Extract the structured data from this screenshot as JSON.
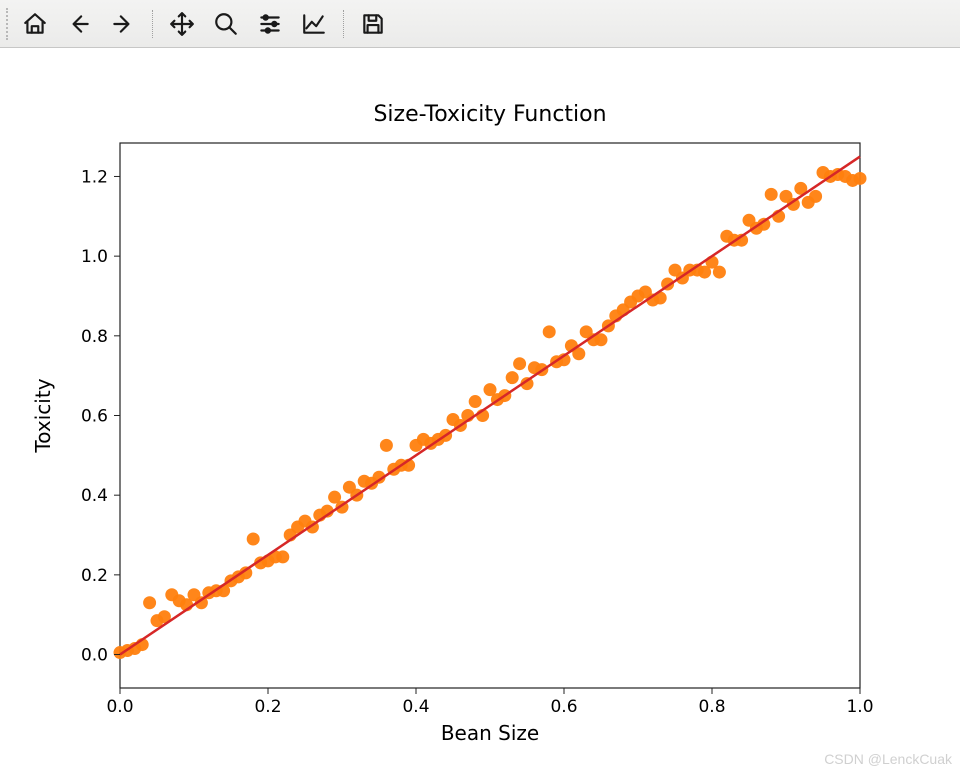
{
  "toolbar": {
    "home": "home-icon",
    "back": "arrow-left-icon",
    "forward": "arrow-right-icon",
    "pan": "move-icon",
    "zoom": "search-icon",
    "subplots": "sliders-icon",
    "axes": "line-chart-icon",
    "save": "save-icon"
  },
  "watermark": "CSDN @LenckCuak",
  "chart_data": {
    "type": "scatter+line",
    "title": "Size-Toxicity Function",
    "xlabel": "Bean Size",
    "ylabel": "Toxicity",
    "xlim": [
      0.0,
      1.0
    ],
    "ylim": [
      0.0,
      1.2
    ],
    "xticks": [
      0.0,
      0.2,
      0.4,
      0.6,
      0.8,
      1.0
    ],
    "yticks": [
      0.0,
      0.2,
      0.4,
      0.6,
      0.8,
      1.0,
      1.2
    ],
    "fit_line": {
      "x": [
        0.0,
        1.0
      ],
      "y": [
        0.0,
        1.25
      ],
      "color": "#d62728"
    },
    "scatter": {
      "color": "#ff7f0e",
      "x": [
        0.0,
        0.01,
        0.02,
        0.03,
        0.04,
        0.05,
        0.06,
        0.07,
        0.08,
        0.09,
        0.1,
        0.11,
        0.12,
        0.13,
        0.14,
        0.15,
        0.16,
        0.17,
        0.18,
        0.19,
        0.2,
        0.21,
        0.22,
        0.23,
        0.24,
        0.25,
        0.26,
        0.27,
        0.28,
        0.29,
        0.3,
        0.31,
        0.32,
        0.33,
        0.34,
        0.35,
        0.36,
        0.37,
        0.38,
        0.39,
        0.4,
        0.41,
        0.42,
        0.43,
        0.44,
        0.45,
        0.46,
        0.47,
        0.48,
        0.49,
        0.5,
        0.51,
        0.52,
        0.53,
        0.54,
        0.55,
        0.56,
        0.57,
        0.58,
        0.59,
        0.6,
        0.61,
        0.62,
        0.63,
        0.64,
        0.65,
        0.66,
        0.67,
        0.68,
        0.69,
        0.7,
        0.71,
        0.72,
        0.73,
        0.74,
        0.75,
        0.76,
        0.77,
        0.78,
        0.79,
        0.8,
        0.81,
        0.82,
        0.83,
        0.84,
        0.85,
        0.86,
        0.87,
        0.88,
        0.89,
        0.9,
        0.91,
        0.92,
        0.93,
        0.94,
        0.95,
        0.96,
        0.97,
        0.98,
        0.99,
        1.0
      ],
      "y": [
        0.005,
        0.01,
        0.015,
        0.025,
        0.13,
        0.085,
        0.095,
        0.15,
        0.135,
        0.125,
        0.15,
        0.13,
        0.155,
        0.16,
        0.16,
        0.185,
        0.195,
        0.205,
        0.29,
        0.23,
        0.235,
        0.245,
        0.245,
        0.3,
        0.32,
        0.335,
        0.32,
        0.35,
        0.36,
        0.395,
        0.37,
        0.42,
        0.4,
        0.435,
        0.43,
        0.445,
        0.525,
        0.465,
        0.475,
        0.475,
        0.525,
        0.54,
        0.53,
        0.54,
        0.55,
        0.59,
        0.575,
        0.6,
        0.635,
        0.6,
        0.665,
        0.64,
        0.65,
        0.695,
        0.73,
        0.68,
        0.72,
        0.715,
        0.81,
        0.735,
        0.74,
        0.775,
        0.755,
        0.81,
        0.79,
        0.79,
        0.825,
        0.85,
        0.865,
        0.885,
        0.9,
        0.91,
        0.89,
        0.895,
        0.93,
        0.965,
        0.945,
        0.965,
        0.965,
        0.96,
        0.985,
        0.96,
        1.05,
        1.04,
        1.04,
        1.09,
        1.07,
        1.08,
        1.155,
        1.1,
        1.15,
        1.13,
        1.17,
        1.135,
        1.15,
        1.21,
        1.2,
        1.205,
        1.2,
        1.19,
        1.195
      ]
    }
  }
}
